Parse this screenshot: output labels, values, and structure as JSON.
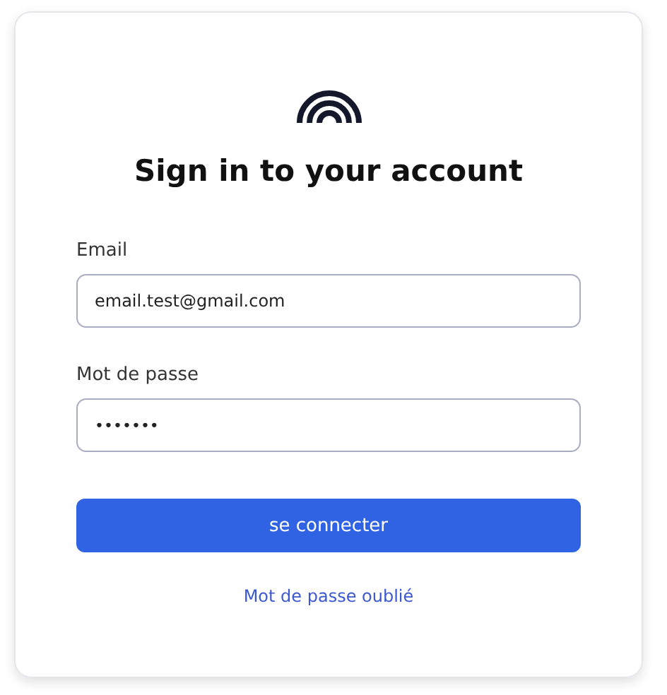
{
  "title": "Sign in to your account",
  "fields": [
    {
      "label": "Email",
      "value": "email.test@gmail.com"
    },
    {
      "label": "Mot de passe",
      "value": "•••••••"
    }
  ],
  "submit_button": "se connecter",
  "forgot_link": "Mot de passe oublié"
}
